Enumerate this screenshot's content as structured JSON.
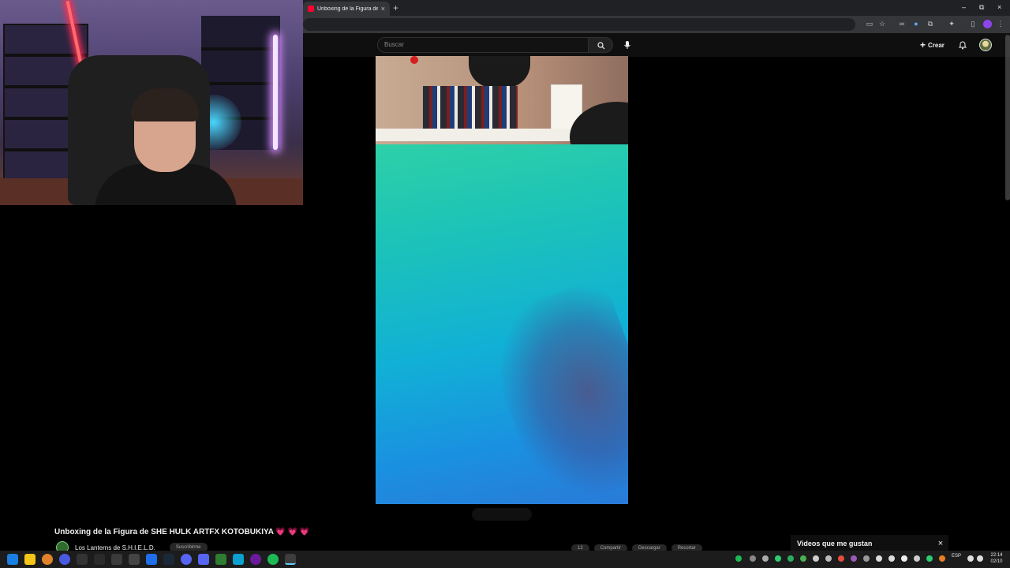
{
  "browser": {
    "tab_title": "Unboxing de la Figura de SHE HULK ARTFX KOTOBUKIYA",
    "tab_close": "×",
    "new_tab": "+",
    "window_controls": [
      "–",
      "⧉",
      "×"
    ]
  },
  "youtube": {
    "search_placeholder": "Buscar",
    "create_label": "Crear",
    "video": {
      "title": "Unboxing de la Figura de SHE HULK ARTFX KOTOBUKIYA",
      "title_hearts": "💗 💗 💗",
      "channel_name": "Los Lanterns de S.H.I.E.L.D.",
      "subscribe_label": "Suscribirme",
      "actions": [
        "12",
        "Compartir",
        "Descargar",
        "Recortar"
      ]
    },
    "liked_panel": {
      "title": "Videos que me gustan",
      "close": "×"
    }
  },
  "taskbar": {
    "language": "ESP",
    "time": "22:14",
    "date": "02/10"
  },
  "colors": {
    "youtube_red": "#ff0033",
    "background": "#0f0f0f",
    "browser_chrome": "#35363a"
  }
}
